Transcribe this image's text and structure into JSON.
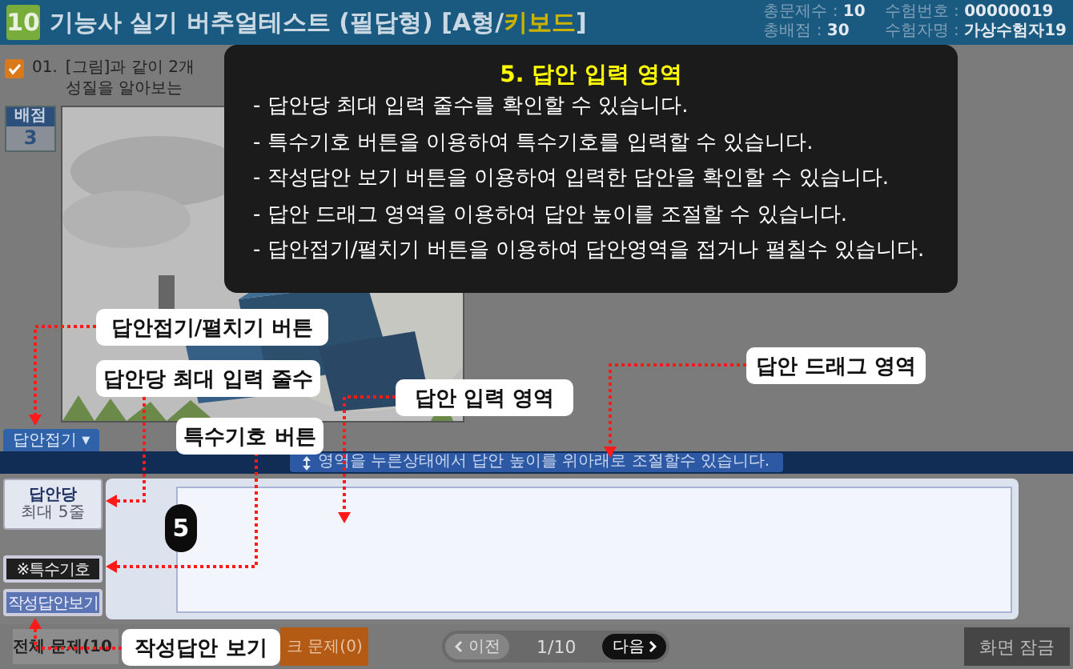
{
  "header": {
    "number": "10",
    "title": "기능사 실기 버추얼테스트 (필답형) [A형/",
    "title_highlight": "키보드",
    "title_end": "]",
    "info": [
      {
        "label": "총문제수",
        "sep": ":",
        "value": "10"
      },
      {
        "label": "수험번호",
        "sep": ":",
        "value": "00000019"
      },
      {
        "label": "총배점",
        "sep": ":",
        "value": "30"
      },
      {
        "label": "수험자명",
        "sep": ":",
        "value": "가상수험자19"
      }
    ]
  },
  "question": {
    "checked": true,
    "number": "01.",
    "lines": [
      "[그림]과 같이 2개",
      "성질을 알아보는"
    ],
    "score_label": "배점",
    "score": "3"
  },
  "answer_panel": {
    "toggle": "답안접기 ▾",
    "drag_hint": "영역을 누른상태에서 답안 높이를 위아래로 조절할수 있습니다.",
    "max_lines_title": "답안당",
    "max_lines": "최대 5줄",
    "symbol_button": "※특수기호",
    "view_button": "작성답안보기"
  },
  "footer": {
    "all": "전체 문제(10",
    "marked": "크 문제(0)",
    "prev": "이전",
    "page": "1/10",
    "next": "다음",
    "lock": "화면 잠금"
  },
  "guide": {
    "title": "5. 답안 입력 영역",
    "lines": [
      "- 답안당 최대 입력 줄수를 확인할 수 있습니다.",
      "- 특수기호 버튼을 이용하여 특수기호를 입력할 수 있습니다.",
      "- 작성답안 보기 버튼을 이용하여 입력한 답안을 확인할 수 있습니다.",
      "- 답안 드래그 영역을 이용하여 답안 높이를 조절할 수 있습니다.",
      "- 답안접기/펼치기 버튼을 이용하여 답안영역을 접거나 펼칠수 있습니다."
    ],
    "step": "5",
    "callouts": [
      "답안접기/펼치기 버튼",
      "답안당 최대 입력 줄수",
      "특수기호 버튼",
      "답안 입력 영역",
      "답안 드래그 영역",
      "작성답안 보기"
    ]
  }
}
